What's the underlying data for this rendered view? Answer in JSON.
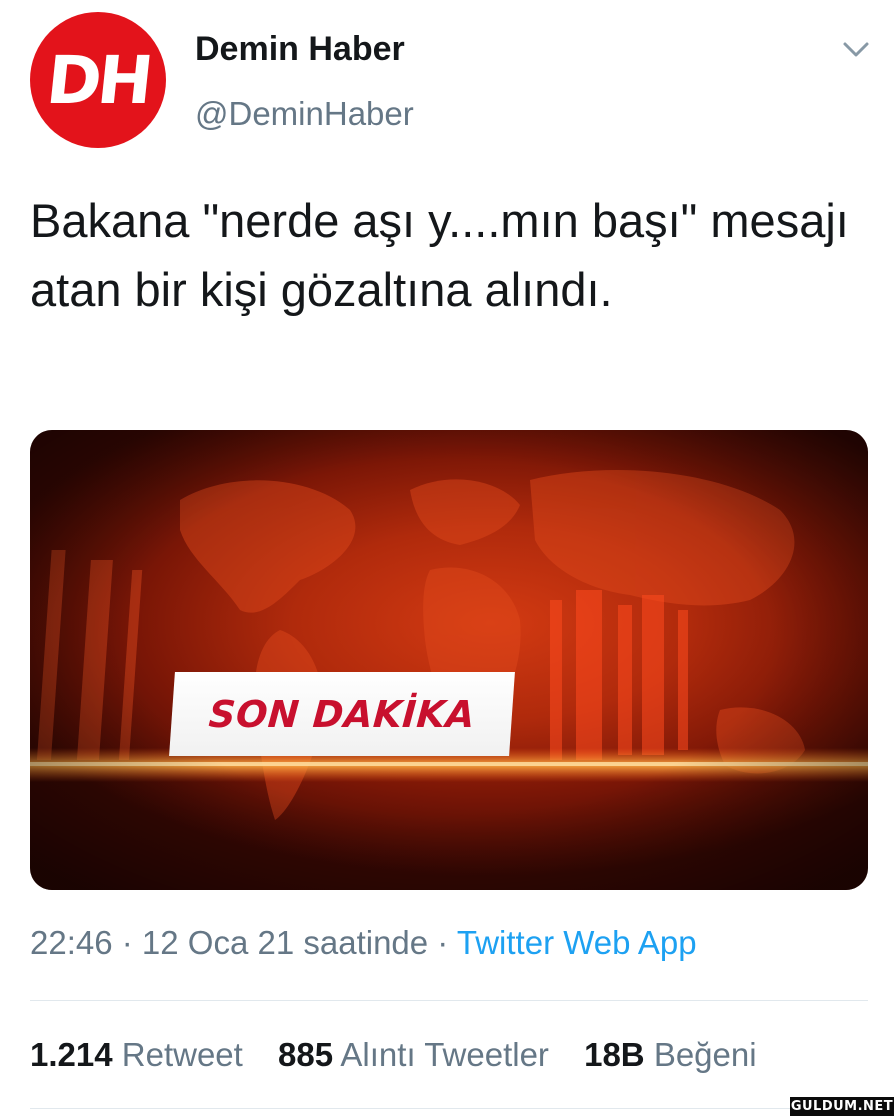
{
  "header": {
    "avatar_logo": "DH",
    "display_name": "Demin Haber",
    "handle": "@DeminHaber"
  },
  "tweet": {
    "text": "Bakana \"nerde aşı y....mın başı\" mesajı atan bir kişi gözaltına alındı.",
    "media_banner": "SON DAKİKA"
  },
  "meta": {
    "time": "22:46",
    "sep1": " · ",
    "date": "12 Oca 21 saatinde",
    "sep2": " · ",
    "source": "Twitter Web App"
  },
  "stats": {
    "retweets_count": "1.214",
    "retweets_label": "Retweet",
    "quotes_count": "885",
    "quotes_label": "Alıntı Tweetler",
    "likes_count": "18B",
    "likes_label": "Beğeni"
  },
  "watermark": "GULDUM.NET",
  "colors": {
    "avatar_bg": "#e3131b",
    "link": "#1da1f2",
    "muted": "#657786",
    "banner_text": "#c8102e"
  },
  "icons": {
    "menu": "chevron-down-icon"
  }
}
